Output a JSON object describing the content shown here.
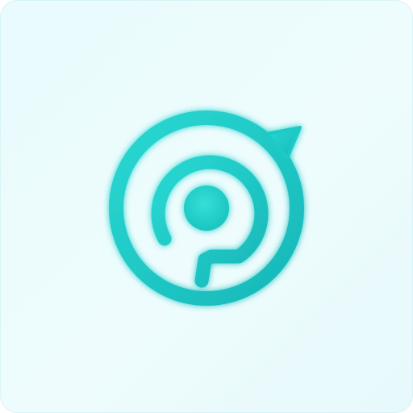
{
  "app_icon": {
    "icon": "chat-bubble-target-logo-icon",
    "colors": {
      "background": "#eafbfd",
      "accent": "#1fd1cc",
      "accent_dark": "#17b9b8",
      "glow": "#7ef0e9"
    }
  }
}
